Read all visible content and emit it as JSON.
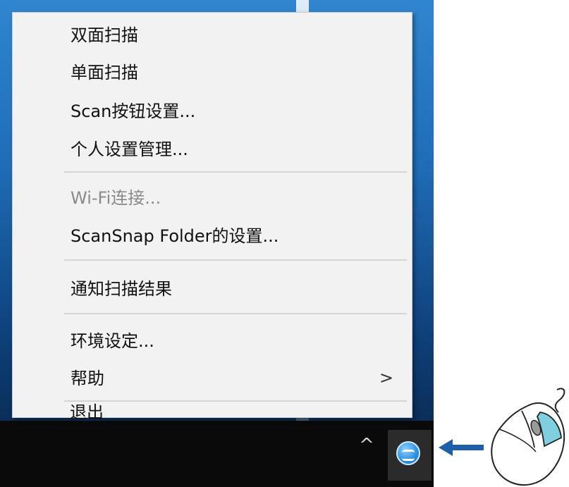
{
  "menu": {
    "items": [
      {
        "label": "双面扫描"
      },
      {
        "label": "单面扫描"
      },
      {
        "label": "Scan按钮设置..."
      },
      {
        "label": "个人设置管理..."
      },
      {
        "label": "Wi-Fi连接...",
        "disabled": true
      },
      {
        "label": "ScanSnap Folder的设置..."
      },
      {
        "label": "通知扫描结果"
      },
      {
        "label": "环境设定..."
      },
      {
        "label": "帮助",
        "submenu_glyph": ">"
      },
      {
        "label": "退出"
      }
    ]
  },
  "taskbar": {
    "overflow_glyph": "^",
    "tray_icon": "scansnap-manager-icon"
  },
  "illustration": {
    "arrow_color": "#1f5ea8",
    "mouse_button_highlight": "#7fcfe0"
  }
}
